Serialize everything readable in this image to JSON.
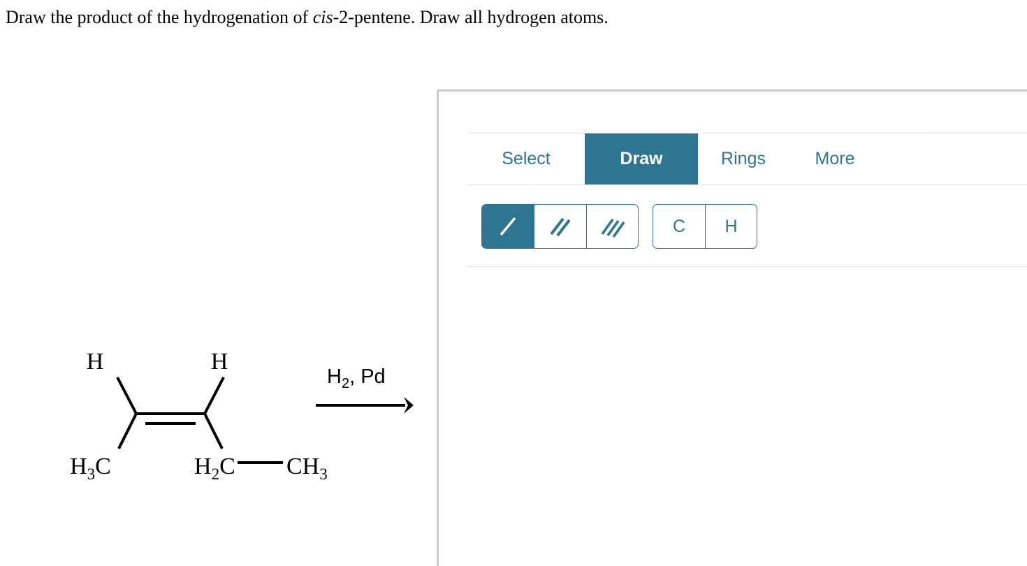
{
  "question": {
    "text_before": "Draw the product of the hydrogenation of ",
    "text_italic": "cis",
    "text_after": "-2-pentene. Draw all hydrogen atoms."
  },
  "reaction": {
    "reactant_name": "cis-2-pentene",
    "labels": {
      "h_top_left": "H",
      "h_top_right": "H",
      "methyl_left_main": "H",
      "methyl_left_sub": "3",
      "methyl_left_tail": "C",
      "methylene_right_main": "H",
      "methylene_right_sub": "2",
      "methylene_right_tail": "C",
      "terminal_methyl_main": "CH",
      "terminal_methyl_sub": "3"
    },
    "arrow": {
      "reagent_main": "H",
      "reagent_sub": "2",
      "reagent_tail": ", Pd"
    }
  },
  "editor": {
    "tabs": [
      {
        "label": "Select",
        "active": false,
        "name": "tab-select"
      },
      {
        "label": "Draw",
        "active": true,
        "name": "tab-draw"
      },
      {
        "label": "Rings",
        "active": false,
        "name": "tab-rings"
      },
      {
        "label": "More",
        "active": false,
        "name": "tab-more"
      }
    ],
    "bond_tools": [
      {
        "icon": "single-bond-icon",
        "selected": true
      },
      {
        "icon": "double-bond-icon",
        "selected": false
      },
      {
        "icon": "triple-bond-icon",
        "selected": false
      }
    ],
    "atom_tools": [
      {
        "label": "C",
        "name": "atom-tool-carbon"
      },
      {
        "label": "H",
        "name": "atom-tool-hydrogen"
      }
    ],
    "canvas_content": ""
  },
  "colors": {
    "accent": "#2e7591",
    "panel_border": "#cccccc",
    "divider": "#e3e3e3",
    "text": "#000000"
  }
}
